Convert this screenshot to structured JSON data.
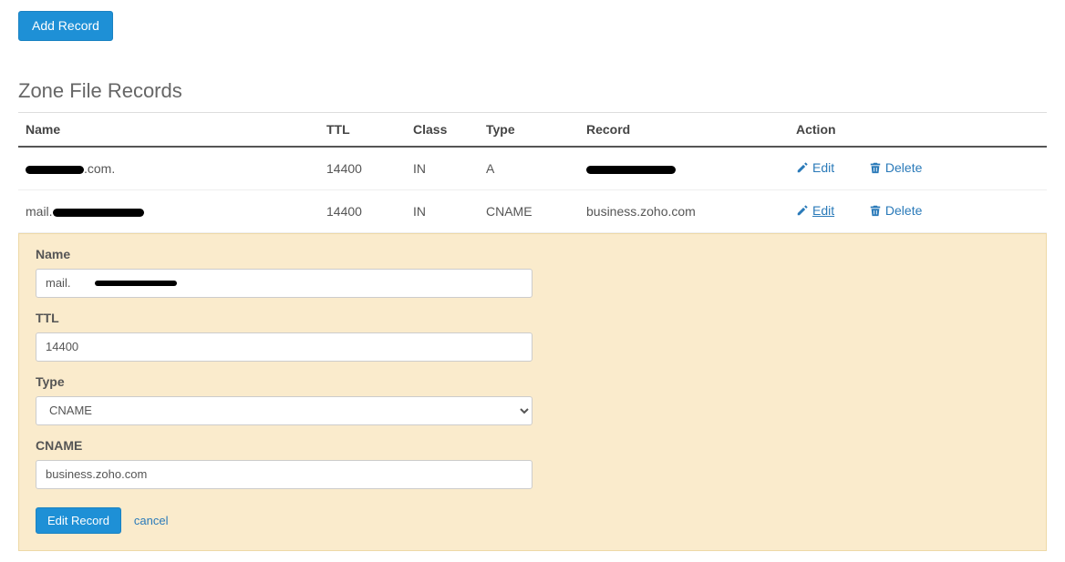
{
  "toolbar": {
    "add_record_label": "Add Record"
  },
  "section_title": "Zone File Records",
  "columns": {
    "name": "Name",
    "ttl": "TTL",
    "class": "Class",
    "type": "Type",
    "record": "Record",
    "action": "Action"
  },
  "actions": {
    "edit": "Edit",
    "delete": "Delete"
  },
  "rows": [
    {
      "name_suffix": ".com.",
      "ttl": "14400",
      "class": "IN",
      "type": "A",
      "record_visible": ""
    },
    {
      "name_prefix": "mail.",
      "ttl": "14400",
      "class": "IN",
      "type": "CNAME",
      "record_visible": "business.zoho.com"
    }
  ],
  "form": {
    "labels": {
      "name": "Name",
      "ttl": "TTL",
      "type": "Type",
      "cname": "CNAME"
    },
    "values": {
      "name_prefix": "mail.",
      "ttl": "14400",
      "type": "CNAME",
      "cname": "business.zoho.com"
    },
    "submit_label": "Edit Record",
    "cancel_label": "cancel"
  }
}
